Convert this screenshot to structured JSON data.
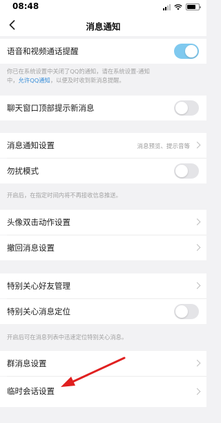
{
  "status_bar": {
    "time": "08:48"
  },
  "nav": {
    "title": "消息通知"
  },
  "rows": {
    "voice_video": {
      "label": "语音和视频通话提醒",
      "toggle": "on"
    },
    "chat_top": {
      "label": "聊天窗口顶部提示新消息",
      "toggle": "off"
    },
    "notify_settings": {
      "label": "消息通知设置",
      "value": "消息预览、提示音等"
    },
    "dnd": {
      "label": "勿扰模式",
      "toggle": "off"
    },
    "avatar_double_tap": {
      "label": "头像双击动作设置"
    },
    "recall": {
      "label": "撤回消息设置"
    },
    "special_friends": {
      "label": "特别关心好友管理"
    },
    "special_locate": {
      "label": "特别关心消息定位",
      "toggle": "off"
    },
    "group_msg": {
      "label": "群消息设置"
    },
    "temp_session": {
      "label": "临时会话设置"
    }
  },
  "notes": {
    "system_line1": "你已在系统设置中关闭了QQ的通知，请在系统设置-通知",
    "system_line2_pre": "中，",
    "system_link": "允许QQ通知",
    "system_line2_post": "，以便及时收到新消息提醒。",
    "dnd_note": "开启后，在指定时间内将不再接收信息推送。",
    "locate_note": "开启后可在消息列表中迅速定位特别关心消息。"
  },
  "colors": {
    "toggle_on": "#7fc9ef",
    "toggle_off": "#e4e4e7",
    "link": "#3a8fd9",
    "arrow": "#e02020",
    "background": "#f2f2f4"
  },
  "icons": [
    "back-chevron-icon",
    "signal-icon",
    "wifi-icon",
    "battery-icon",
    "chevron-right-icon",
    "red-arrow-annotation"
  ]
}
